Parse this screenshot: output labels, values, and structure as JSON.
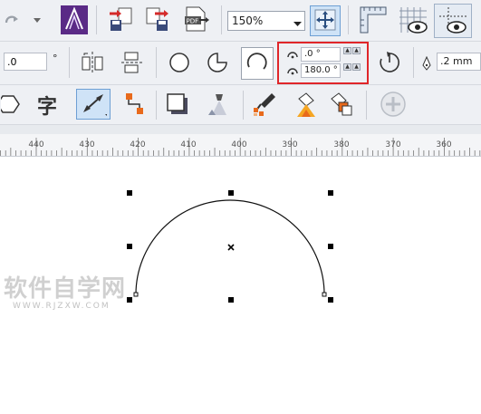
{
  "toolbar": {
    "zoom_value": "150%",
    "zoom_dropdown_icon": "chevron-down-icon",
    "pdf_label": "PDF"
  },
  "property_bar": {
    "angle_value": ".0",
    "angle_unit": "°",
    "start_angle": ".0 °",
    "end_angle": "180.0 °",
    "outline_width": ".2 mm",
    "highlight_color": "#e0262a"
  },
  "ruler": {
    "labels": [
      "440",
      "430",
      "420",
      "410",
      "400",
      "390",
      "380",
      "370",
      "360"
    ]
  },
  "watermark": {
    "main": "软件自学网",
    "sub": "WWW.RJZXW.COM"
  }
}
